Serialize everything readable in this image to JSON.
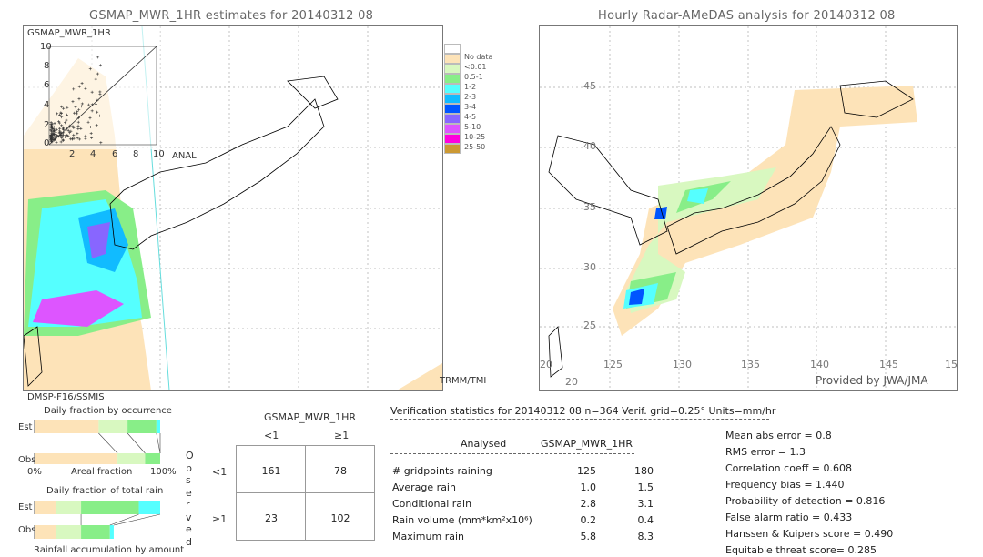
{
  "left_panel": {
    "title": "GSMAP_MWR_1HR estimates for 20140312 08",
    "inset_title": "GSMAP_MWR_1HR",
    "inset_xlabel": "ANAL",
    "inset_ticks": [
      "0",
      "2",
      "4",
      "6",
      "8",
      "10"
    ],
    "satellite_label": "DMSP-F16/SSMIS",
    "swath_label": "TRMM/TMI"
  },
  "right_panel": {
    "title": "Hourly Radar-AMeDAS analysis for 20140312 08",
    "lat_ticks": [
      "45",
      "40",
      "35",
      "30",
      "25",
      "20"
    ],
    "lon_ticks": [
      "20",
      "125",
      "130",
      "135",
      "140",
      "145",
      "15"
    ],
    "bottom_lat_label": "20",
    "credit": "Provided by JWA/JMA"
  },
  "legend": {
    "items": [
      {
        "label": "",
        "color": "#ffffff"
      },
      {
        "label": "No data",
        "color": "#fde3b8"
      },
      {
        "label": "<0.01",
        "color": "#d8f8c0"
      },
      {
        "label": "0.5-1",
        "color": "#88ee88"
      },
      {
        "label": "1-2",
        "color": "#55ffff"
      },
      {
        "label": "2-3",
        "color": "#11bbff"
      },
      {
        "label": "3-4",
        "color": "#0055ff"
      },
      {
        "label": "4-5",
        "color": "#8866ff"
      },
      {
        "label": "5-10",
        "color": "#dd55ff"
      },
      {
        "label": "10-25",
        "color": "#ff00dd"
      },
      {
        "label": "25-50",
        "color": "#cc9933"
      }
    ]
  },
  "fraction_charts": {
    "occurrence_title": "Daily fraction by occurrence",
    "total_rain_title": "Daily fraction of total rain",
    "est_label": "Est",
    "obs_label": "Obs",
    "axis_left": "0%",
    "axis_mid": "Areal fraction",
    "axis_right": "100%",
    "footer": "Rainfall accumulation by amount",
    "occurrence_est": [
      0.51,
      0.23,
      0.23,
      0.03
    ],
    "occurrence_obs": [
      0.66,
      0.22,
      0.12,
      0.0
    ],
    "rain_est": [
      0.17,
      0.2,
      0.46,
      0.17
    ],
    "rain_obs": [
      0.17,
      0.2,
      0.23,
      0.03
    ],
    "colors": [
      "#fde3b8",
      "#d8f8c0",
      "#88ee88",
      "#55ffff"
    ]
  },
  "contingency": {
    "header": "GSMAP_MWR_1HR",
    "col_labels": [
      "<1",
      "≥1"
    ],
    "row_labels": [
      "<1",
      "≥1"
    ],
    "side_label": "Observed",
    "cells": [
      [
        "161",
        "78"
      ],
      [
        "23",
        "102"
      ]
    ]
  },
  "verification": {
    "header": "Verification statistics for 20140312 08   n=364   Verif. grid=0.25°   Units=mm/hr",
    "col_analysed": "Analysed",
    "col_model": "GSMAP_MWR_1HR",
    "rows": [
      {
        "label": "# gridpoints raining",
        "analysed": "125",
        "model": "180"
      },
      {
        "label": "Average rain",
        "analysed": "1.0",
        "model": "1.5"
      },
      {
        "label": "Conditional rain",
        "analysed": "2.8",
        "model": "3.1"
      },
      {
        "label": "Rain volume (mm*km²x10⁶)",
        "analysed": "0.2",
        "model": "0.4"
      },
      {
        "label": "Maximum rain",
        "analysed": "5.8",
        "model": "8.3"
      }
    ],
    "scores": [
      "Mean abs error = 0.8",
      "RMS error = 1.3",
      "Correlation coeff = 0.608",
      "Frequency bias = 1.440",
      "Probability of detection = 0.816",
      "False alarm ratio = 0.433",
      "Hanssen & Kuipers score = 0.490",
      "Equitable threat score= 0.285"
    ]
  }
}
